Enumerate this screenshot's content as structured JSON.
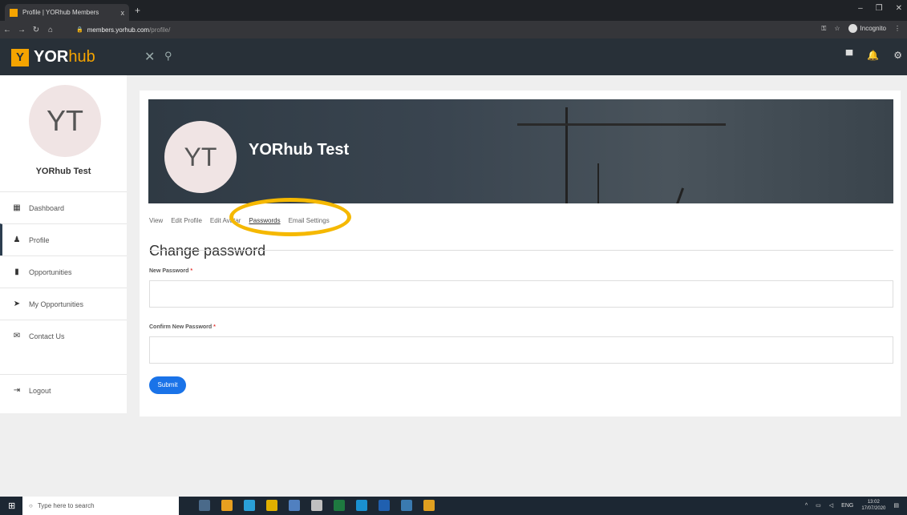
{
  "browser": {
    "tab_title": "Profile | YORhub Members",
    "tab_close": "x",
    "new_tab": "+",
    "url_host": "members.yorhub.com",
    "url_path": "/profile/",
    "incognito_label": "Incognito"
  },
  "header": {
    "logo_letter": "Y",
    "logo_bold": "YOR",
    "logo_light": "hub"
  },
  "sidebar": {
    "avatar_initials": "YT",
    "user_name": "YORhub Test",
    "items": [
      {
        "label": "Dashboard",
        "icon": "dashboard-icon"
      },
      {
        "label": "Profile",
        "icon": "person-icon"
      },
      {
        "label": "Opportunities",
        "icon": "document-icon"
      },
      {
        "label": "My Opportunities",
        "icon": "arrow-icon"
      },
      {
        "label": "Contact Us",
        "icon": "mail-icon"
      }
    ],
    "logout_label": "Logout"
  },
  "profile": {
    "avatar_initials": "YT",
    "name": "YORhub Test",
    "tabs": [
      "View",
      "Edit Profile",
      "Edit Avatar",
      "Passwords",
      "Email Settings"
    ],
    "active_tab": "Passwords"
  },
  "form": {
    "title": "Change password",
    "new_password_label": "New Password",
    "confirm_password_label": "Confirm New Password",
    "required_mark": "*",
    "submit_label": "Submit"
  },
  "taskbar": {
    "search_placeholder": "Type here to search",
    "lang": "ENG",
    "time": "13:02",
    "date": "17/07/2020"
  },
  "colors": {
    "brand": "#f5a400",
    "header_bg": "#283038",
    "submit": "#1a73e8",
    "highlight": "#f5b800"
  }
}
